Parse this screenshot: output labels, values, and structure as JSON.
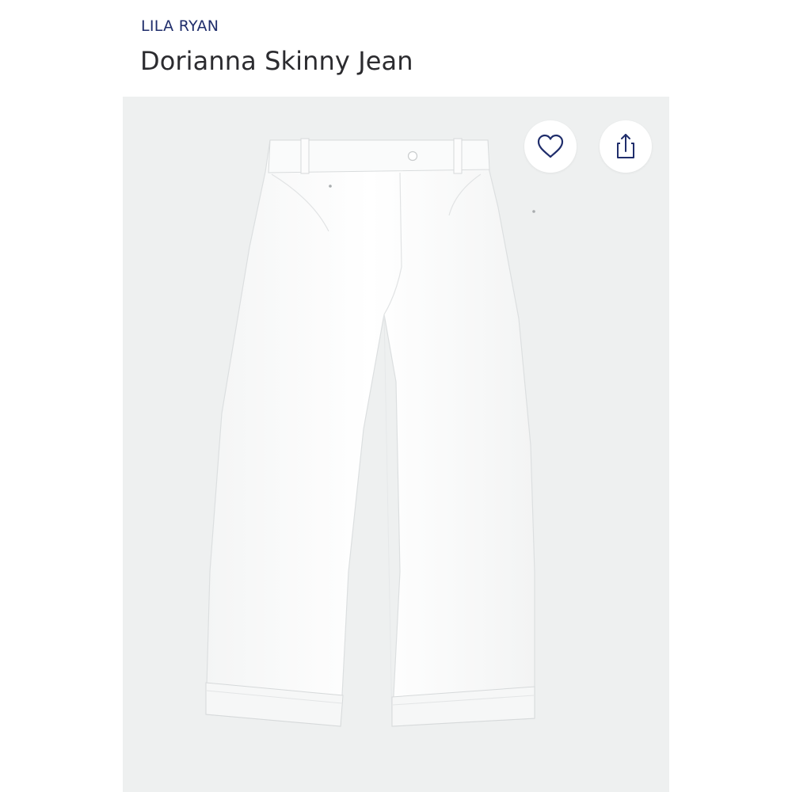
{
  "header": {
    "brand": "LILA RYAN",
    "title": "Dorianna Skinny Jean"
  },
  "actions": {
    "favorite_icon": "heart-icon",
    "share_icon": "share-icon"
  },
  "colors": {
    "brand": "#1f2d6b",
    "title": "#2b2b2f",
    "image_background": "#eef0f0",
    "icon_stroke": "#1f2d6b"
  }
}
